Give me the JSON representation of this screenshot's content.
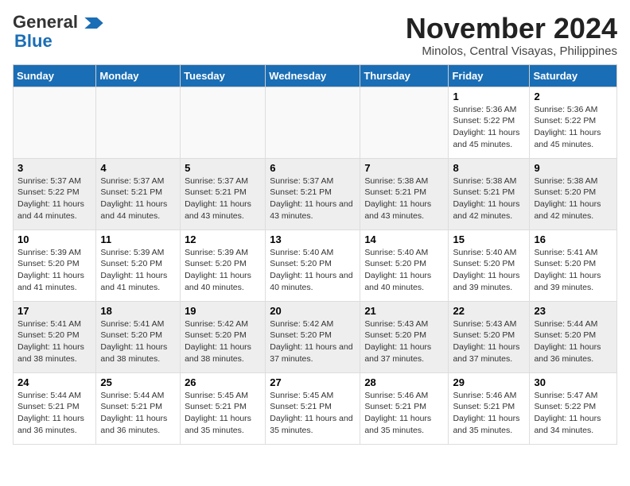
{
  "logo": {
    "line1": "General",
    "line2": "Blue"
  },
  "title": "November 2024",
  "subtitle": "Minolos, Central Visayas, Philippines",
  "weekdays": [
    "Sunday",
    "Monday",
    "Tuesday",
    "Wednesday",
    "Thursday",
    "Friday",
    "Saturday"
  ],
  "weeks": [
    [
      {
        "day": "",
        "info": ""
      },
      {
        "day": "",
        "info": ""
      },
      {
        "day": "",
        "info": ""
      },
      {
        "day": "",
        "info": ""
      },
      {
        "day": "",
        "info": ""
      },
      {
        "day": "1",
        "info": "Sunrise: 5:36 AM\nSunset: 5:22 PM\nDaylight: 11 hours and 45 minutes."
      },
      {
        "day": "2",
        "info": "Sunrise: 5:36 AM\nSunset: 5:22 PM\nDaylight: 11 hours and 45 minutes."
      }
    ],
    [
      {
        "day": "3",
        "info": "Sunrise: 5:37 AM\nSunset: 5:22 PM\nDaylight: 11 hours and 44 minutes."
      },
      {
        "day": "4",
        "info": "Sunrise: 5:37 AM\nSunset: 5:21 PM\nDaylight: 11 hours and 44 minutes."
      },
      {
        "day": "5",
        "info": "Sunrise: 5:37 AM\nSunset: 5:21 PM\nDaylight: 11 hours and 43 minutes."
      },
      {
        "day": "6",
        "info": "Sunrise: 5:37 AM\nSunset: 5:21 PM\nDaylight: 11 hours and 43 minutes."
      },
      {
        "day": "7",
        "info": "Sunrise: 5:38 AM\nSunset: 5:21 PM\nDaylight: 11 hours and 43 minutes."
      },
      {
        "day": "8",
        "info": "Sunrise: 5:38 AM\nSunset: 5:21 PM\nDaylight: 11 hours and 42 minutes."
      },
      {
        "day": "9",
        "info": "Sunrise: 5:38 AM\nSunset: 5:20 PM\nDaylight: 11 hours and 42 minutes."
      }
    ],
    [
      {
        "day": "10",
        "info": "Sunrise: 5:39 AM\nSunset: 5:20 PM\nDaylight: 11 hours and 41 minutes."
      },
      {
        "day": "11",
        "info": "Sunrise: 5:39 AM\nSunset: 5:20 PM\nDaylight: 11 hours and 41 minutes."
      },
      {
        "day": "12",
        "info": "Sunrise: 5:39 AM\nSunset: 5:20 PM\nDaylight: 11 hours and 40 minutes."
      },
      {
        "day": "13",
        "info": "Sunrise: 5:40 AM\nSunset: 5:20 PM\nDaylight: 11 hours and 40 minutes."
      },
      {
        "day": "14",
        "info": "Sunrise: 5:40 AM\nSunset: 5:20 PM\nDaylight: 11 hours and 40 minutes."
      },
      {
        "day": "15",
        "info": "Sunrise: 5:40 AM\nSunset: 5:20 PM\nDaylight: 11 hours and 39 minutes."
      },
      {
        "day": "16",
        "info": "Sunrise: 5:41 AM\nSunset: 5:20 PM\nDaylight: 11 hours and 39 minutes."
      }
    ],
    [
      {
        "day": "17",
        "info": "Sunrise: 5:41 AM\nSunset: 5:20 PM\nDaylight: 11 hours and 38 minutes."
      },
      {
        "day": "18",
        "info": "Sunrise: 5:41 AM\nSunset: 5:20 PM\nDaylight: 11 hours and 38 minutes."
      },
      {
        "day": "19",
        "info": "Sunrise: 5:42 AM\nSunset: 5:20 PM\nDaylight: 11 hours and 38 minutes."
      },
      {
        "day": "20",
        "info": "Sunrise: 5:42 AM\nSunset: 5:20 PM\nDaylight: 11 hours and 37 minutes."
      },
      {
        "day": "21",
        "info": "Sunrise: 5:43 AM\nSunset: 5:20 PM\nDaylight: 11 hours and 37 minutes."
      },
      {
        "day": "22",
        "info": "Sunrise: 5:43 AM\nSunset: 5:20 PM\nDaylight: 11 hours and 37 minutes."
      },
      {
        "day": "23",
        "info": "Sunrise: 5:44 AM\nSunset: 5:20 PM\nDaylight: 11 hours and 36 minutes."
      }
    ],
    [
      {
        "day": "24",
        "info": "Sunrise: 5:44 AM\nSunset: 5:21 PM\nDaylight: 11 hours and 36 minutes."
      },
      {
        "day": "25",
        "info": "Sunrise: 5:44 AM\nSunset: 5:21 PM\nDaylight: 11 hours and 36 minutes."
      },
      {
        "day": "26",
        "info": "Sunrise: 5:45 AM\nSunset: 5:21 PM\nDaylight: 11 hours and 35 minutes."
      },
      {
        "day": "27",
        "info": "Sunrise: 5:45 AM\nSunset: 5:21 PM\nDaylight: 11 hours and 35 minutes."
      },
      {
        "day": "28",
        "info": "Sunrise: 5:46 AM\nSunset: 5:21 PM\nDaylight: 11 hours and 35 minutes."
      },
      {
        "day": "29",
        "info": "Sunrise: 5:46 AM\nSunset: 5:21 PM\nDaylight: 11 hours and 35 minutes."
      },
      {
        "day": "30",
        "info": "Sunrise: 5:47 AM\nSunset: 5:22 PM\nDaylight: 11 hours and 34 minutes."
      }
    ]
  ]
}
